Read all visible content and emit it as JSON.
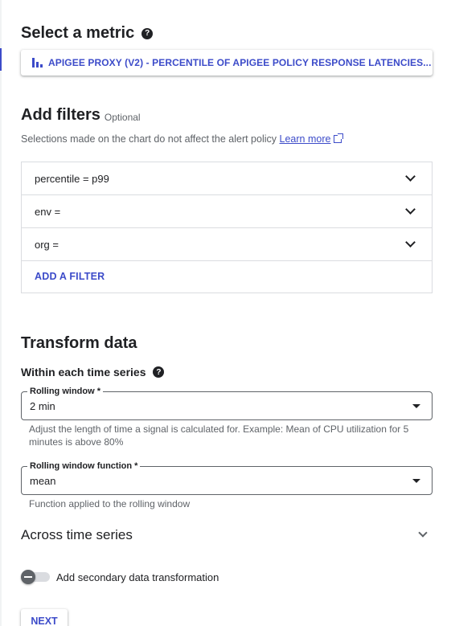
{
  "metric": {
    "title": "Select a metric",
    "help_icon": "?",
    "selected": "APIGEE PROXY (V2) - PERCENTILE OF APIGEE POLICY RESPONSE LATENCIES..."
  },
  "filters": {
    "title": "Add filters",
    "optional": "Optional",
    "description": "Selections made on the chart do not affect the alert policy",
    "learn_more": "Learn more",
    "rows": [
      {
        "label": "percentile = p99"
      },
      {
        "label": "env ="
      },
      {
        "label": "org ="
      }
    ],
    "add_filter": "ADD A FILTER"
  },
  "transform": {
    "title": "Transform data",
    "within_title": "Within each time series",
    "help_icon": "?",
    "rolling_window": {
      "label": "Rolling window *",
      "value": "2 min",
      "hint": "Adjust the length of time a signal is calculated for. Example: Mean of CPU utilization for 5 minutes is above 80%"
    },
    "rolling_function": {
      "label": "Rolling window function *",
      "value": "mean",
      "hint": "Function applied to the rolling window"
    },
    "across_title": "Across time series",
    "secondary_label": "Add secondary data transformation"
  },
  "next_button": "NEXT",
  "colors": {
    "accent": "#3c4bc9",
    "text": "#202124",
    "muted": "#5f6368",
    "border": "#dadce0"
  }
}
